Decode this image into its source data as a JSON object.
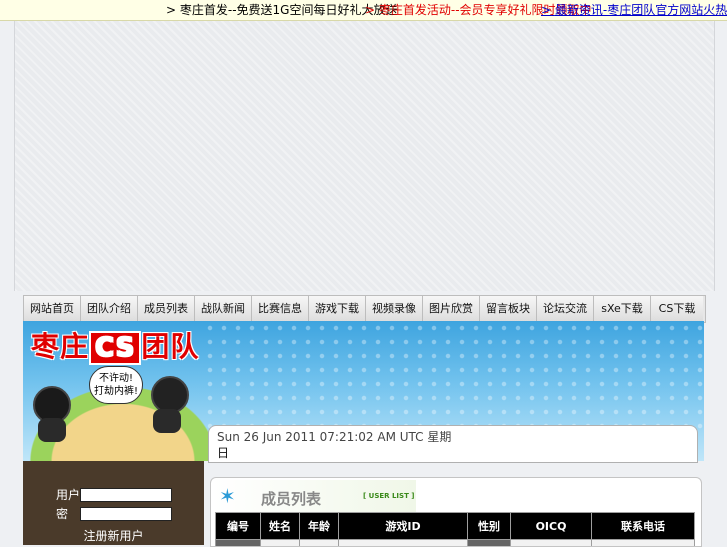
{
  "top_links": [
    {
      "prefix": ">",
      "text": "枣庄首发--免费送1G空间每日好礼大放送"
    },
    {
      "prefix": ">",
      "text": "枣庄首发活动--会员专享好礼限时领取中"
    },
    {
      "prefix": ">",
      "text": "最新资讯-枣庄团队官方网站火热招募中"
    }
  ],
  "nav": {
    "items": [
      "网站首页",
      "团队介绍",
      "成员列表",
      "战队新闻",
      "比赛信息",
      "游戏下载",
      "视频录像",
      "图片欣赏",
      "留言板块",
      "论坛交流",
      "sXe下载",
      "CS下载"
    ]
  },
  "header": {
    "logo_prefix": "枣庄",
    "logo_cs": "CS",
    "logo_suffix": "团队",
    "speech_line1": "不许动!",
    "speech_line2": "打劫内裤!"
  },
  "date_panel": {
    "line1": "Sun 26 Jun 2011 07:21:02 AM UTC 星期",
    "line2": "日"
  },
  "login": {
    "username_label": "用户名:",
    "password_label": "密　码:",
    "register_label": "注册新用户"
  },
  "member_list": {
    "title": "成员列表",
    "subtitle": "[ USER LIST ]",
    "columns": [
      "编号",
      "姓名",
      "年龄",
      "游戏ID",
      "性别",
      "OICQ",
      "联系电话"
    ]
  },
  "colors": {
    "top_red": "#e00000",
    "top_blue": "#0000cc",
    "header_sky": "#3ea4df"
  }
}
